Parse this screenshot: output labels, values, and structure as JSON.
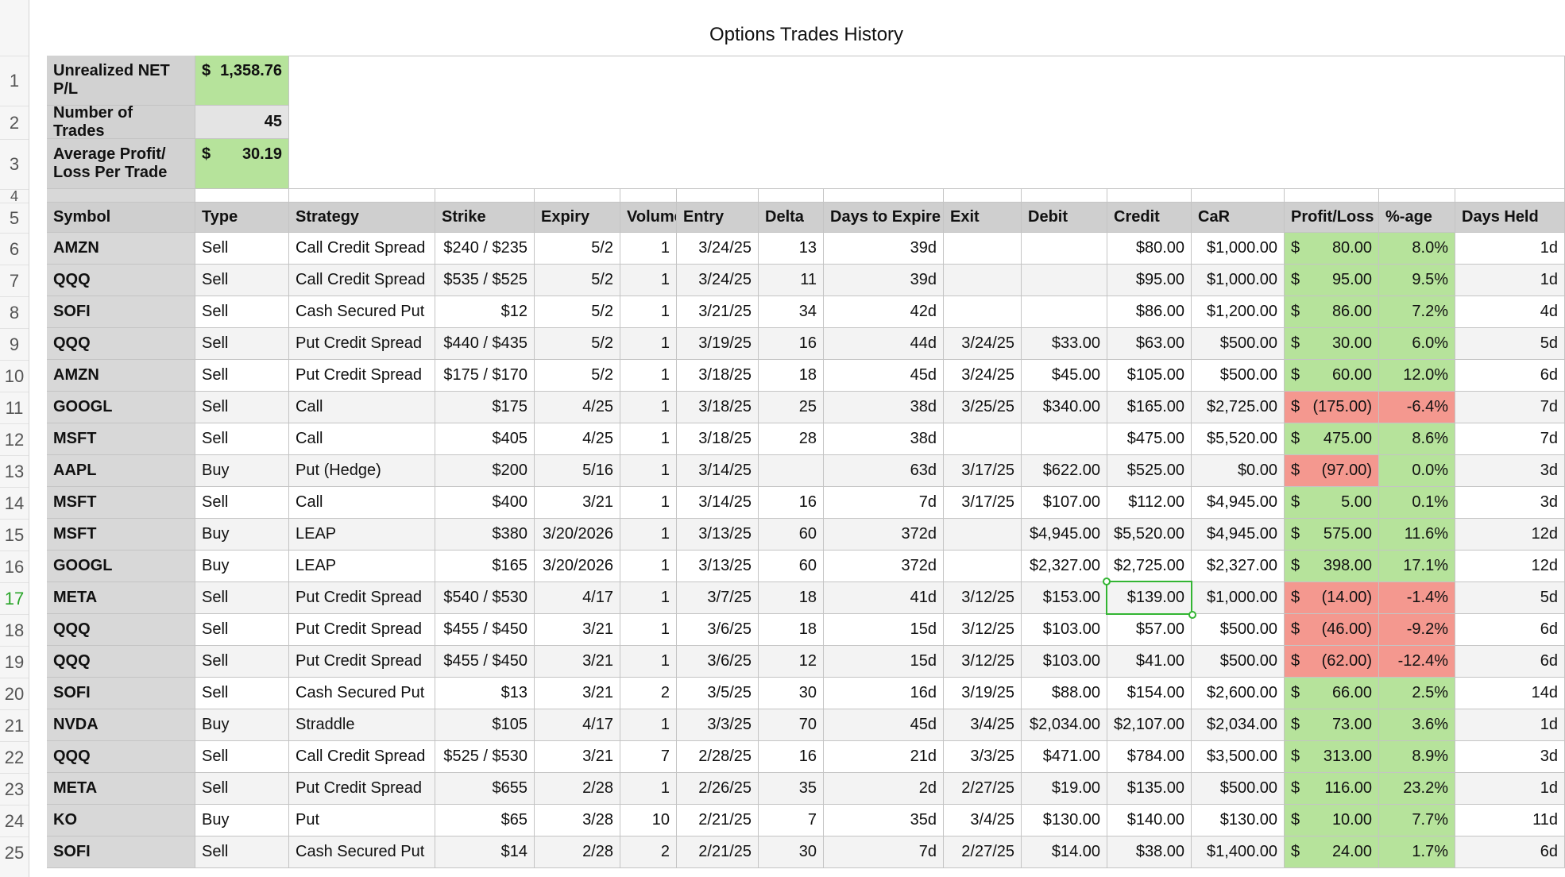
{
  "title": "Options Trades History",
  "row_numbers": [
    "1",
    "2",
    "3",
    "4",
    "5",
    "6",
    "7",
    "8",
    "9",
    "10",
    "11",
    "12",
    "13",
    "14",
    "15",
    "16",
    "17",
    "18",
    "19",
    "20",
    "21",
    "22",
    "23",
    "24",
    "25"
  ],
  "selected_row": "17",
  "summary": [
    {
      "label": "Unrealized NET P/L",
      "currency": "$",
      "value": "1,358.76",
      "style": "green"
    },
    {
      "label": "Number of Trades",
      "currency": "",
      "value": "45",
      "style": "gray"
    },
    {
      "label": "Average Profit/ Loss Per Trade",
      "currency": "$",
      "value": "30.19",
      "style": "green"
    }
  ],
  "headers": [
    "Symbol",
    "Type",
    "Strategy",
    "Strike",
    "Expiry",
    "Volume",
    "Entry",
    "Delta",
    "Days to Expire",
    "Exit",
    "Debit",
    "Credit",
    "CaR",
    "Profit/Loss",
    "%-age",
    "Days Held"
  ],
  "pl_currency": "$",
  "rows": [
    [
      "AMZN",
      "Sell",
      "Call Credit Spread",
      "$240 / $235",
      "5/2",
      "1",
      "3/24/25",
      "13",
      "39d",
      "",
      "",
      "$80.00",
      "$1,000.00",
      "80.00",
      "8.0%",
      "1d"
    ],
    [
      "QQQ",
      "Sell",
      "Call Credit Spread",
      "$535 / $525",
      "5/2",
      "1",
      "3/24/25",
      "11",
      "39d",
      "",
      "",
      "$95.00",
      "$1,000.00",
      "95.00",
      "9.5%",
      "1d"
    ],
    [
      "SOFI",
      "Sell",
      "Cash Secured Put",
      "$12",
      "5/2",
      "1",
      "3/21/25",
      "34",
      "42d",
      "",
      "",
      "$86.00",
      "$1,200.00",
      "86.00",
      "7.2%",
      "4d"
    ],
    [
      "QQQ",
      "Sell",
      "Put Credit Spread",
      "$440 / $435",
      "5/2",
      "1",
      "3/19/25",
      "16",
      "44d",
      "3/24/25",
      "$33.00",
      "$63.00",
      "$500.00",
      "30.00",
      "6.0%",
      "5d"
    ],
    [
      "AMZN",
      "Sell",
      "Put Credit Spread",
      "$175 / $170",
      "5/2",
      "1",
      "3/18/25",
      "18",
      "45d",
      "3/24/25",
      "$45.00",
      "$105.00",
      "$500.00",
      "60.00",
      "12.0%",
      "6d"
    ],
    [
      "GOOGL",
      "Sell",
      "Call",
      "$175",
      "4/25",
      "1",
      "3/18/25",
      "25",
      "38d",
      "3/25/25",
      "$340.00",
      "$165.00",
      "$2,725.00",
      "(175.00)",
      "-6.4%",
      "7d"
    ],
    [
      "MSFT",
      "Sell",
      "Call",
      "$405",
      "4/25",
      "1",
      "3/18/25",
      "28",
      "38d",
      "",
      "",
      "$475.00",
      "$5,520.00",
      "475.00",
      "8.6%",
      "7d"
    ],
    [
      "AAPL",
      "Buy",
      "Put (Hedge)",
      "$200",
      "5/16",
      "1",
      "3/14/25",
      "",
      "63d",
      "3/17/25",
      "$622.00",
      "$525.00",
      "$0.00",
      "(97.00)",
      "0.0%",
      "3d"
    ],
    [
      "MSFT",
      "Sell",
      "Call",
      "$400",
      "3/21",
      "1",
      "3/14/25",
      "16",
      "7d",
      "3/17/25",
      "$107.00",
      "$112.00",
      "$4,945.00",
      "5.00",
      "0.1%",
      "3d"
    ],
    [
      "MSFT",
      "Buy",
      "LEAP",
      "$380",
      "3/20/2026",
      "1",
      "3/13/25",
      "60",
      "372d",
      "",
      "$4,945.00",
      "$5,520.00",
      "$4,945.00",
      "575.00",
      "11.6%",
      "12d"
    ],
    [
      "GOOGL",
      "Buy",
      "LEAP",
      "$165",
      "3/20/2026",
      "1",
      "3/13/25",
      "60",
      "372d",
      "",
      "$2,327.00",
      "$2,725.00",
      "$2,327.00",
      "398.00",
      "17.1%",
      "12d"
    ],
    [
      "META",
      "Sell",
      "Put Credit Spread",
      "$540 / $530",
      "4/17",
      "1",
      "3/7/25",
      "18",
      "41d",
      "3/12/25",
      "$153.00",
      "$139.00",
      "$1,000.00",
      "(14.00)",
      "-1.4%",
      "5d"
    ],
    [
      "QQQ",
      "Sell",
      "Put Credit Spread",
      "$455 / $450",
      "3/21",
      "1",
      "3/6/25",
      "18",
      "15d",
      "3/12/25",
      "$103.00",
      "$57.00",
      "$500.00",
      "(46.00)",
      "-9.2%",
      "6d"
    ],
    [
      "QQQ",
      "Sell",
      "Put Credit Spread",
      "$455 / $450",
      "3/21",
      "1",
      "3/6/25",
      "12",
      "15d",
      "3/12/25",
      "$103.00",
      "$41.00",
      "$500.00",
      "(62.00)",
      "-12.4%",
      "6d"
    ],
    [
      "SOFI",
      "Sell",
      "Cash Secured Put",
      "$13",
      "3/21",
      "2",
      "3/5/25",
      "30",
      "16d",
      "3/19/25",
      "$88.00",
      "$154.00",
      "$2,600.00",
      "66.00",
      "2.5%",
      "14d"
    ],
    [
      "NVDA",
      "Buy",
      "Straddle",
      "$105",
      "4/17",
      "1",
      "3/3/25",
      "70",
      "45d",
      "3/4/25",
      "$2,034.00",
      "$2,107.00",
      "$2,034.00",
      "73.00",
      "3.6%",
      "1d"
    ],
    [
      "QQQ",
      "Sell",
      "Call Credit Spread",
      "$525 / $530",
      "3/21",
      "7",
      "2/28/25",
      "16",
      "21d",
      "3/3/25",
      "$471.00",
      "$784.00",
      "$3,500.00",
      "313.00",
      "8.9%",
      "3d"
    ],
    [
      "META",
      "Sell",
      "Put Credit Spread",
      "$655",
      "2/28",
      "1",
      "2/26/25",
      "35",
      "2d",
      "2/27/25",
      "$19.00",
      "$135.00",
      "$500.00",
      "116.00",
      "23.2%",
      "1d"
    ],
    [
      "KO",
      "Buy",
      "Put",
      "$65",
      "3/28",
      "10",
      "2/21/25",
      "7",
      "35d",
      "3/4/25",
      "$130.00",
      "$140.00",
      "$130.00",
      "10.00",
      "7.7%",
      "11d"
    ],
    [
      "SOFI",
      "Sell",
      "Cash Secured Put",
      "$14",
      "2/28",
      "2",
      "2/21/25",
      "30",
      "7d",
      "2/27/25",
      "$14.00",
      "$38.00",
      "$1,400.00",
      "24.00",
      "1.7%",
      "6d"
    ]
  ],
  "colors": {
    "positive": "#b6e39b",
    "negative": "#f4988f",
    "header": "#cfcfcf",
    "selection": "#33b533"
  }
}
